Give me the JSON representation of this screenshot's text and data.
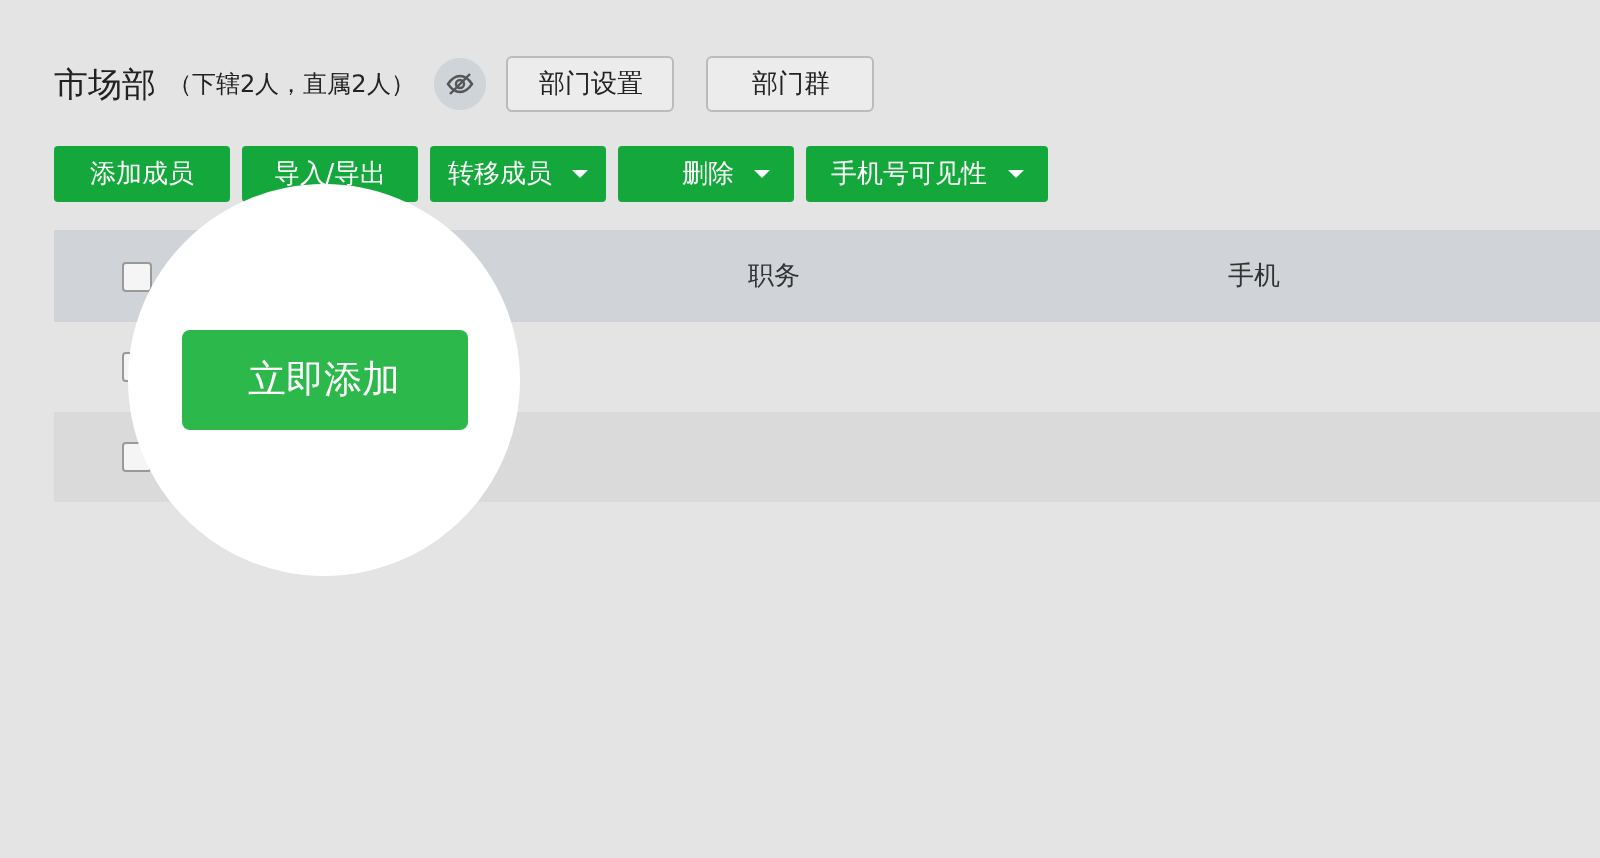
{
  "header": {
    "title": "市场部",
    "subtitle": "（下辖2人，直属2人）",
    "buttons": [
      "部门设置",
      "部门群"
    ]
  },
  "toolbar": [
    {
      "label": "添加成员",
      "dropdown": false
    },
    {
      "label": "导入/导出",
      "dropdown": false
    },
    {
      "label": "转移成员",
      "dropdown": true
    },
    {
      "label": "删除",
      "dropdown": true
    },
    {
      "label": "手机号可见性",
      "dropdown": true
    }
  ],
  "table": {
    "header_checked": false,
    "columns": [
      "职务",
      "手机"
    ],
    "rows": [
      {
        "checked": false
      },
      {
        "checked": false
      }
    ]
  },
  "spotlight": {
    "button": "立即添加"
  }
}
